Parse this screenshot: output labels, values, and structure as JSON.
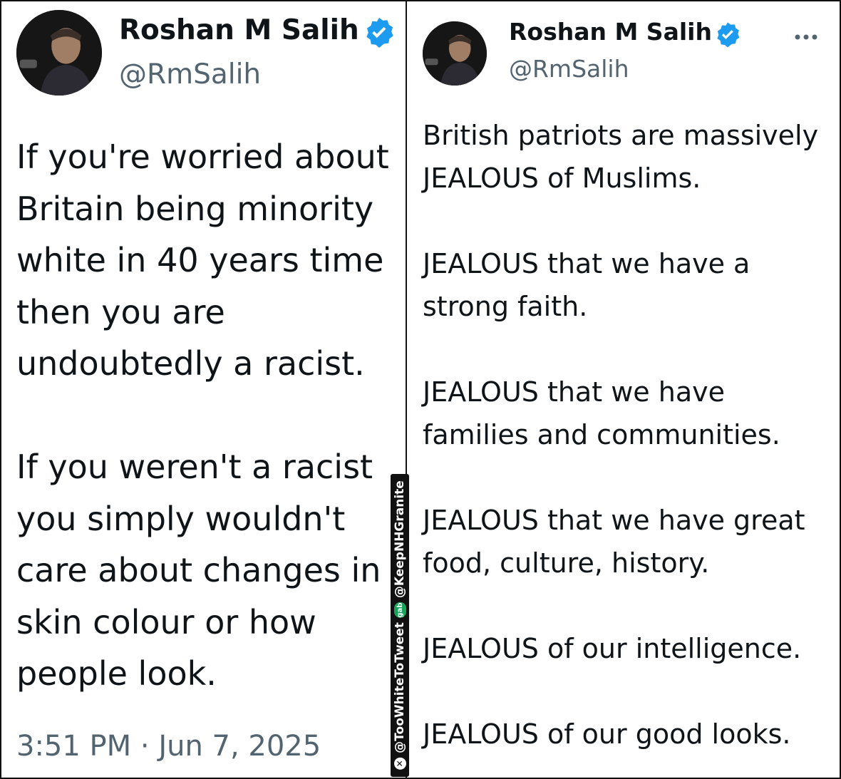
{
  "left_tweet": {
    "author_name": "Roshan M Salih",
    "handle": "@RmSalih",
    "text": "If you're worried about\nBritain being minority\nwhite in 40 years time\nthen you are\nundoubtedly a racist.\n\nIf you weren't a racist\nyou simply wouldn't\ncare about changes in\nskin colour or how\npeople look.",
    "timestamp": "3:51 PM · Jun 7, 2025"
  },
  "right_tweet": {
    "author_name": "Roshan M Salih",
    "handle": "@RmSalih",
    "text": "British patriots are massively\nJEALOUS of Muslims.\n\nJEALOUS that we have a\nstrong faith.\n\nJEALOUS that we have\nfamilies and communities.\n\nJEALOUS that we have great\nfood, culture, history.\n\nJEALOUS of our intelligence.\n\nJEALOUS of our good looks."
  },
  "watermark": {
    "x_handle": "@TooWhiteToTweet",
    "gab_label": "gab",
    "gab_handle": "@KeepNHGranite"
  },
  "colors": {
    "verified_blue": "#1d9bf0",
    "secondary_text": "#536471",
    "primary_text": "#0f1419",
    "gab_green": "#19a45c"
  },
  "icons": [
    "verified-badge-icon",
    "more-options-icon",
    "x-logo-icon",
    "gab-logo-icon"
  ]
}
